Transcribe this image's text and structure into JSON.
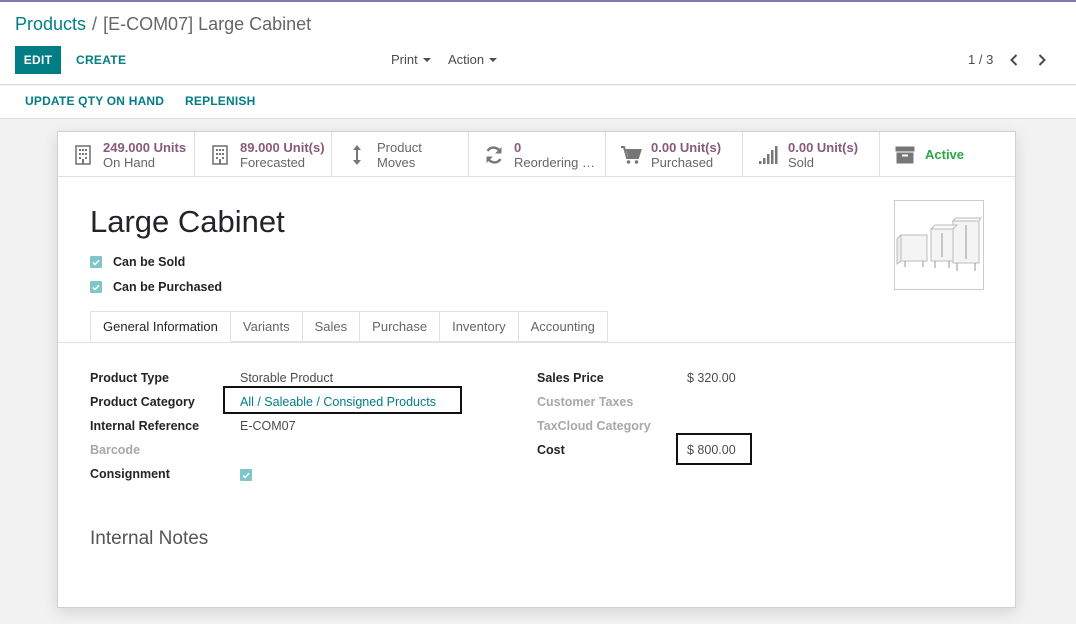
{
  "breadcrumb": {
    "parent": "Products",
    "separator": "/",
    "current": "[E-COM07] Large Cabinet"
  },
  "toolbar": {
    "edit_label": "EDIT",
    "create_label": "CREATE",
    "print_label": "Print",
    "action_label": "Action"
  },
  "pager": {
    "text": "1 / 3"
  },
  "statusbar": {
    "update_qty_label": "UPDATE QTY ON HAND",
    "replenish_label": "REPLENISH"
  },
  "smart_buttons": [
    {
      "value": "249.000 Units",
      "label": "On Hand",
      "icon": "building-icon"
    },
    {
      "value": "89.000 Unit(s)",
      "label": "Forecasted",
      "icon": "building-icon"
    },
    {
      "value": "Product",
      "label": "Moves",
      "icon": "up-down-arrows-icon"
    },
    {
      "value": "0",
      "label": "Reordering Rules",
      "icon": "refresh-icon"
    },
    {
      "value": "0.00 Unit(s)",
      "label": "Purchased",
      "icon": "cart-icon"
    },
    {
      "value": "0.00 Unit(s)",
      "label": "Sold",
      "icon": "signal-bars-icon"
    },
    {
      "value": "Active",
      "icon": "archive-icon"
    }
  ],
  "product": {
    "name": "Large Cabinet",
    "can_be_sold_label": "Can be Sold",
    "can_be_purchased_label": "Can be Purchased"
  },
  "tabs": [
    "General Information",
    "Variants",
    "Sales",
    "Purchase",
    "Inventory",
    "Accounting"
  ],
  "fields_left": {
    "product_type_label": "Product Type",
    "product_type_value": "Storable Product",
    "product_category_label": "Product Category",
    "product_category_value": "All / Saleable / Consigned Products",
    "internal_reference_label": "Internal Reference",
    "internal_reference_value": "E-COM07",
    "barcode_label": "Barcode",
    "consignment_label": "Consignment"
  },
  "fields_right": {
    "sales_price_label": "Sales Price",
    "sales_price_value": "$ 320.00",
    "customer_taxes_label": "Customer Taxes",
    "taxcloud_category_label": "TaxCloud Category",
    "cost_label": "Cost",
    "cost_value": "$ 800.00"
  },
  "notes": {
    "title": "Internal Notes"
  },
  "colors": {
    "primary": "#017e84",
    "smart_value": "#875a7b",
    "active": "#28a745",
    "checkbox": "#7ec6ca"
  }
}
